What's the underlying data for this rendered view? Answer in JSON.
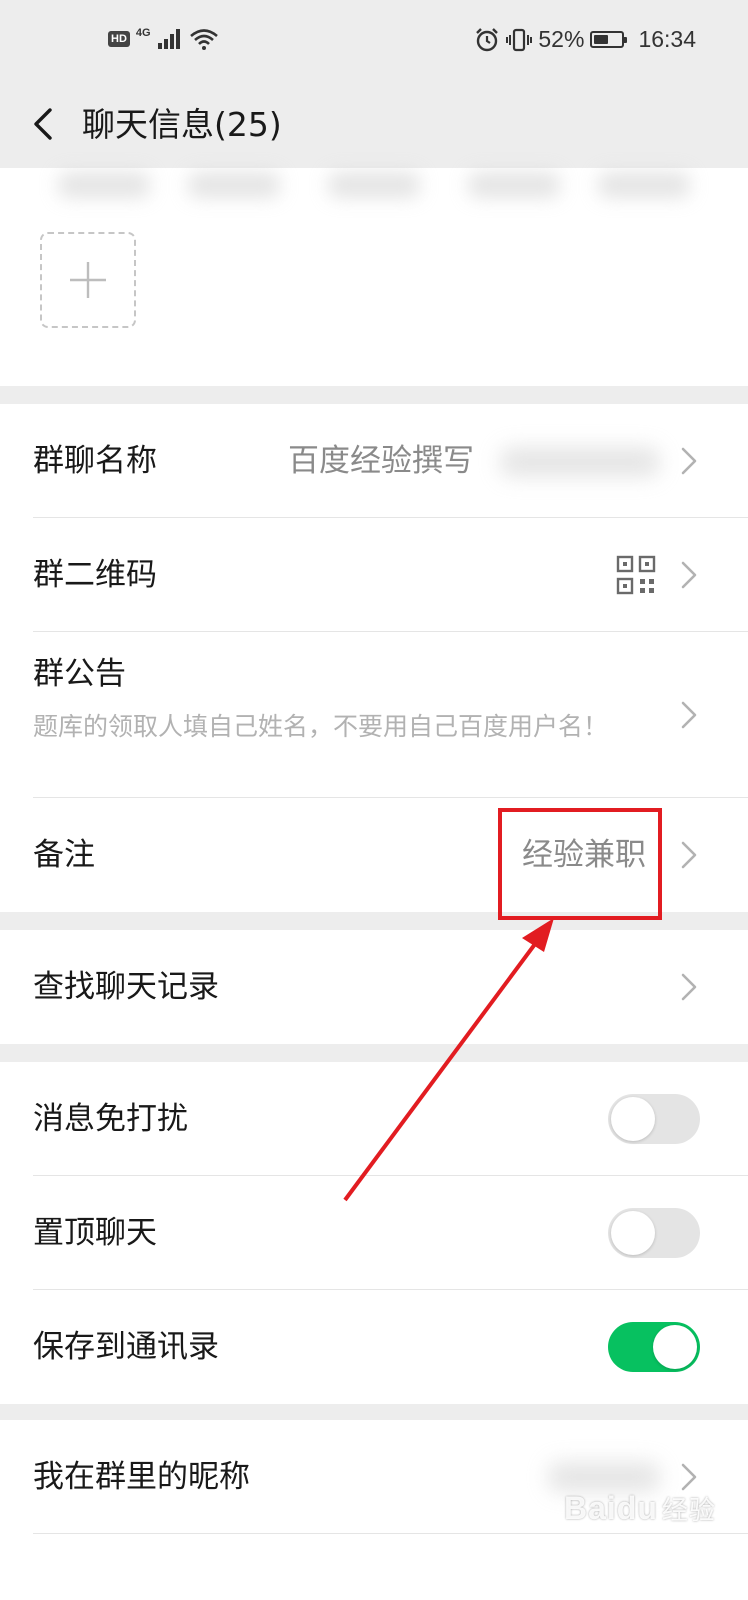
{
  "status_bar": {
    "hd_label": "HD",
    "network_label": "4G",
    "battery_percent_text": "52%",
    "battery_level": 0.52,
    "time": "16:34"
  },
  "header": {
    "title": "聊天信息(25)"
  },
  "settings": {
    "group_name": {
      "label": "群聊名称",
      "value": "百度经验撰写"
    },
    "group_qrcode": {
      "label": "群二维码"
    },
    "group_notice": {
      "label": "群公告",
      "text": "题库的领取人填自己姓名，不要用自己百度用户名！"
    },
    "remark": {
      "label": "备注",
      "value": "经验兼职"
    },
    "search_history": {
      "label": "查找聊天记录"
    },
    "mute_notifications": {
      "label": "消息免打扰",
      "on": false
    },
    "sticky_on_top": {
      "label": "置顶聊天",
      "on": false
    },
    "save_to_contacts": {
      "label": "保存到通讯录",
      "on": true
    },
    "my_group_nickname": {
      "label": "我在群里的昵称"
    }
  },
  "colors": {
    "background": "#ededed",
    "card": "#ffffff",
    "toggle_on": "#07c160",
    "annotation_red": "#e21c21"
  },
  "watermark": {
    "brand": "Baidu",
    "cn": "经验"
  }
}
